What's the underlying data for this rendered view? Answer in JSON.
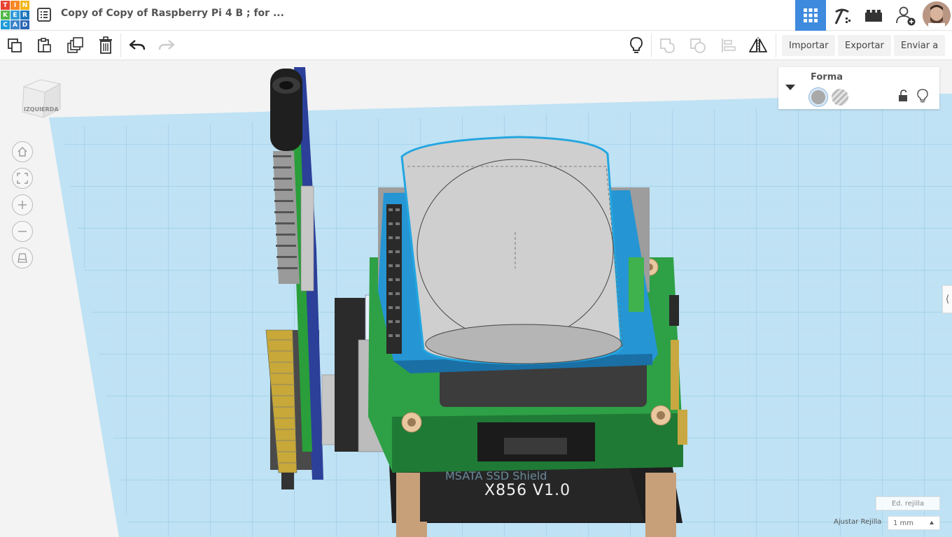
{
  "header": {
    "logo_letters": [
      "TIN",
      "KER",
      "CAD"
    ],
    "document_title": "Copy of Copy of Raspberry Pi 4 B ; for ...",
    "icons": [
      "list-icon",
      "grid-view-icon",
      "pickaxe-icon",
      "bricks-icon",
      "add-user-icon",
      "avatar"
    ],
    "accent_color": "#3e8ade"
  },
  "toolbar": {
    "import_label": "Importar",
    "export_label": "Exportar",
    "send_label": "Enviar a",
    "icons": [
      "copy-icon",
      "paste-icon",
      "duplicate-icon",
      "delete-icon",
      "undo-icon",
      "redo-icon",
      "note-bulb-icon",
      "group-icon",
      "ungroup-icon",
      "align-icon",
      "mirror-icon"
    ]
  },
  "view_cube": {
    "label": "IZQUIERDA"
  },
  "shape_panel": {
    "title": "Forma",
    "solid_color": "#a9a9a9"
  },
  "board_text": {
    "line1": "MSATA SSD Shield",
    "line2": "X856  V1.0"
  },
  "grid_controls": {
    "edit_grid_label": "Ed. rejilla",
    "snap_label": "Ajustar Rejilla",
    "snap_value": "1 mm"
  }
}
